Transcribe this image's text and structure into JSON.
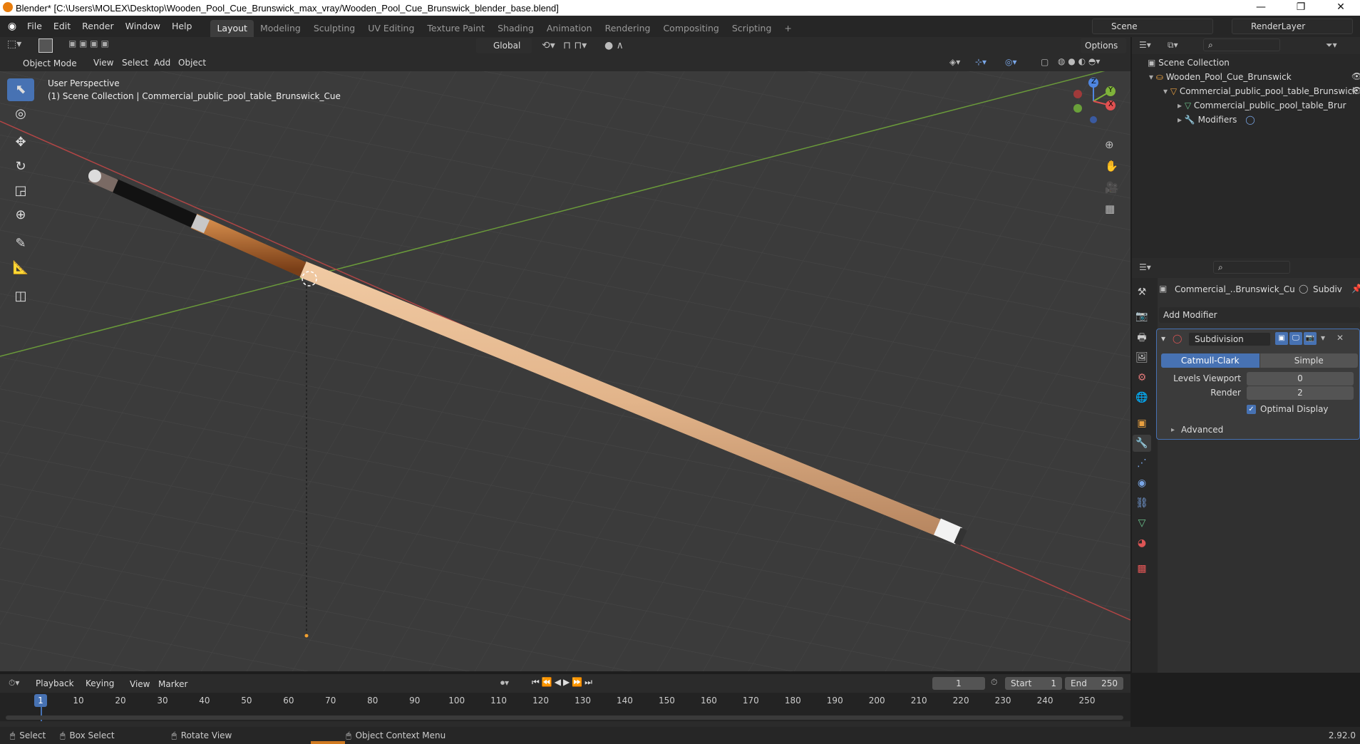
{
  "window": {
    "title": "Blender* [C:\\Users\\MOLEX\\Desktop\\Wooden_Pool_Cue_Brunswick_max_vray/Wooden_Pool_Cue_Brunswick_blender_base.blend]",
    "minimize": "—",
    "restore": "❐",
    "close": "✕"
  },
  "menus": [
    "File",
    "Edit",
    "Render",
    "Window",
    "Help"
  ],
  "workspaces": [
    "Layout",
    "Modeling",
    "Sculpting",
    "UV Editing",
    "Texture Paint",
    "Shading",
    "Animation",
    "Rendering",
    "Compositing",
    "Scripting"
  ],
  "add_workspace": "+",
  "scene": {
    "label": "Scene",
    "render_layer": "RenderLayer"
  },
  "viewport_header": {
    "mode": "Object Mode",
    "menus": [
      "View",
      "Select",
      "Add",
      "Object"
    ],
    "orientation": "Global",
    "options": "Options"
  },
  "viewport": {
    "perspective": "User Perspective",
    "collection_info": "(1) Scene Collection | Commercial_public_pool_table_Brunswick_Cue",
    "gizmo": {
      "x": "X",
      "y": "Y",
      "z": "Z"
    }
  },
  "outliner": {
    "root": "Scene Collection",
    "items": [
      {
        "label": "Wooden_Pool_Cue_Brunswick",
        "icon": "collection-icon"
      },
      {
        "label": "Commercial_public_pool_table_Brunswick",
        "icon": "object-icon"
      },
      {
        "label": "Commercial_public_pool_table_Brur",
        "icon": "mesh-icon"
      },
      {
        "label": "Modifiers",
        "icon": "wrench-icon"
      }
    ]
  },
  "properties": {
    "object_name": "Commercial_..Brunswick_Cu",
    "modifier_short": "Subdiv",
    "add_modifier": "Add Modifier",
    "modifier": {
      "name": "Subdivision",
      "types": [
        "Catmull-Clark",
        "Simple"
      ],
      "active_type": "Catmull-Clark",
      "levels_viewport_label": "Levels Viewport",
      "levels_viewport": "0",
      "render_label": "Render",
      "render": "2",
      "optimal_display_label": "Optimal Display",
      "optimal_display": true,
      "advanced": "Advanced"
    }
  },
  "timeline": {
    "menus": [
      "Playback",
      "Keying",
      "View",
      "Marker"
    ],
    "current_frame": "1",
    "start_label": "Start",
    "start": "1",
    "end_label": "End",
    "end": "250",
    "ticks": [
      "1",
      "10",
      "20",
      "30",
      "40",
      "50",
      "60",
      "70",
      "80",
      "90",
      "100",
      "110",
      "120",
      "130",
      "140",
      "150",
      "160",
      "170",
      "180",
      "190",
      "200",
      "210",
      "220",
      "230",
      "240",
      "250"
    ]
  },
  "statusbar": {
    "select": "Select",
    "box_select": "Box Select",
    "rotate_view": "Rotate View",
    "context_menu": "Object Context Menu",
    "version": "2.92.0"
  },
  "colors": {
    "accent": "#4772b3",
    "viewport_bg": "#3b3b3b",
    "x_axis": "#b04545",
    "y_axis": "#6a9a3a",
    "cue_wood": "#e2b48a"
  }
}
